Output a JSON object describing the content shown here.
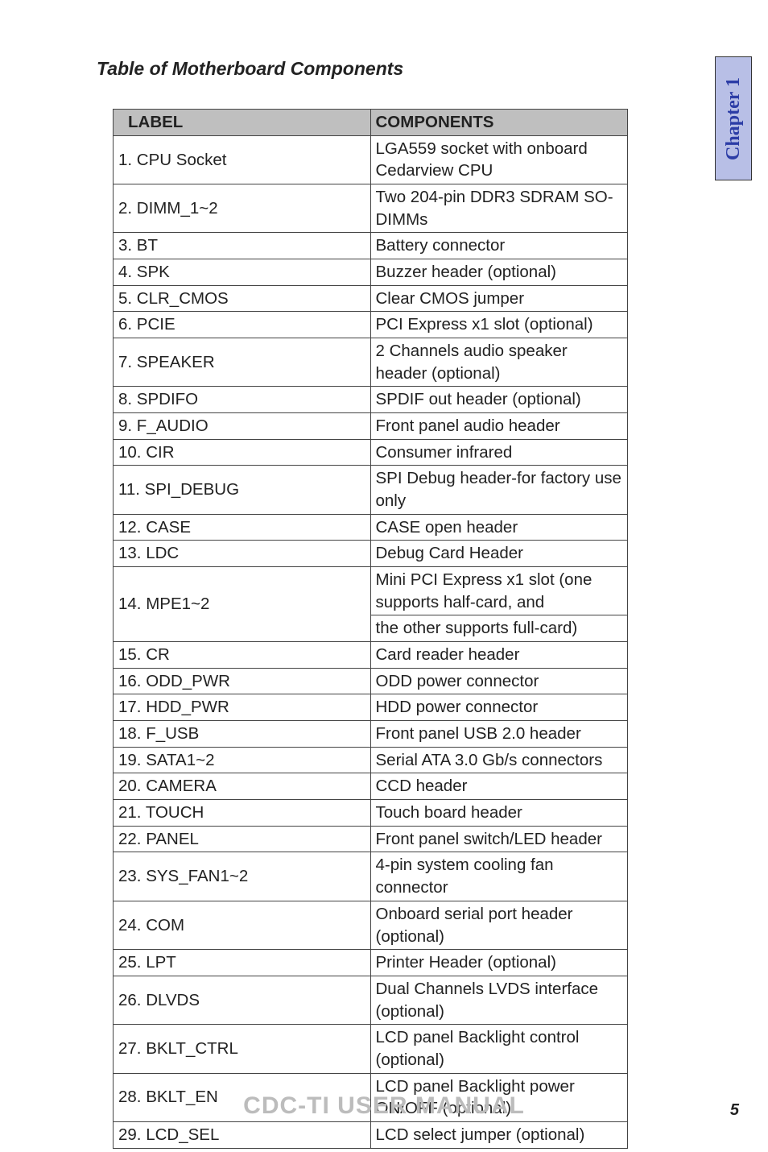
{
  "section_title": "Table of Motherboard Components",
  "chapter_tab": "Chapter 1",
  "footer": "CDC-TI  USER MANUAL",
  "page_number": "5",
  "table": {
    "headers": {
      "label": "LABEL",
      "components": "COMPONENTS"
    },
    "rows": [
      {
        "label": "1. CPU Socket",
        "desc": "LGA559 socket with onboard Cedarview CPU"
      },
      {
        "label": "2. DIMM_1~2",
        "desc": "Two 204-pin DDR3 SDRAM SO-DIMMs"
      },
      {
        "label": "3. BT",
        "desc": "Battery connector"
      },
      {
        "label": "4. SPK",
        "desc": "Buzzer header (optional)"
      },
      {
        "label": "5. CLR_CMOS",
        "desc": "Clear CMOS jumper"
      },
      {
        "label": "6. PCIE",
        "desc": "PCI Express x1 slot (optional)"
      },
      {
        "label": "7. SPEAKER",
        "desc": "2 Channels audio speaker header (optional)"
      },
      {
        "label": "8. SPDIFO",
        "desc": "SPDIF out header (optional)"
      },
      {
        "label": "9. F_AUDIO",
        "desc": "Front panel audio header"
      },
      {
        "label": "10. CIR",
        "desc": "Consumer infrared"
      },
      {
        "label": "11. SPI_DEBUG",
        "desc": "SPI Debug header-for factory use only"
      },
      {
        "label": "12. CASE",
        "desc": "CASE open header"
      },
      {
        "label": "13. LDC",
        "desc": "Debug Card Header"
      },
      {
        "label": "14. MPE1~2",
        "desc": "Mini PCI Express x1 slot (one supports half-card, and the other supports full-card)",
        "rowspan": 2,
        "desc1": "Mini PCI Express x1 slot (one supports half-card, and",
        "desc2": "the other supports full-card)"
      },
      {
        "label": "15. CR",
        "desc": "Card reader header"
      },
      {
        "label": "16. ODD_PWR",
        "desc": "ODD power connector"
      },
      {
        "label": "17. HDD_PWR",
        "desc": "HDD power connector"
      },
      {
        "label": "18. F_USB",
        "desc": "Front panel USB 2.0  header"
      },
      {
        "label": "19. SATA1~2",
        "desc": "Serial ATA 3.0 Gb/s connectors"
      },
      {
        "label": "20. CAMERA",
        "desc": "CCD header"
      },
      {
        "label": "21. TOUCH",
        "desc": "Touch board header"
      },
      {
        "label": "22. PANEL",
        "desc": "Front panel switch/LED header"
      },
      {
        "label": "23. SYS_FAN1~2",
        "desc": "4-pin system cooling fan connector"
      },
      {
        "label": "24. COM",
        "desc": "Onboard serial port header (optional)"
      },
      {
        "label": "25. LPT",
        "desc": "Printer Header (optional)"
      },
      {
        "label": "26. DLVDS",
        "desc": "Dual Channels LVDS interface (optional)"
      },
      {
        "label": "27. BKLT_CTRL",
        "desc": "LCD panel Backlight control (optional)"
      },
      {
        "label": "28. BKLT_EN",
        "desc": "LCD panel Backlight power ON/OFF (optional)"
      },
      {
        "label": "29. LCD_SEL",
        "desc": "LCD select jumper (optional)"
      }
    ]
  }
}
